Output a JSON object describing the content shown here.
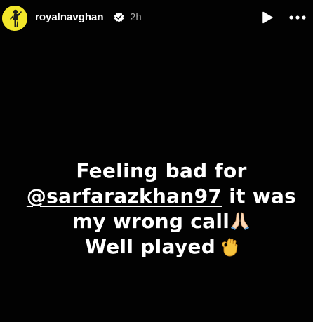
{
  "header": {
    "username": "royalnavghan",
    "verified": true,
    "timestamp": "2h",
    "avatar_icon": "avatar-cricket-player",
    "play_icon": "play-icon",
    "more_icon": "more-icon"
  },
  "story": {
    "line1": "Feeling bad for",
    "mention": "@sarfarazkhan97",
    "line2_rest": " it was",
    "line3": "my wrong call",
    "line3_emoji": "folded-hands-emoji",
    "line4": "Well played",
    "line4_emoji": "ok-hand-emoji"
  },
  "colors": {
    "background": "#020202",
    "text": "#ffffff",
    "timestamp": "#a8a8a8",
    "avatar": "#f2e62a"
  }
}
